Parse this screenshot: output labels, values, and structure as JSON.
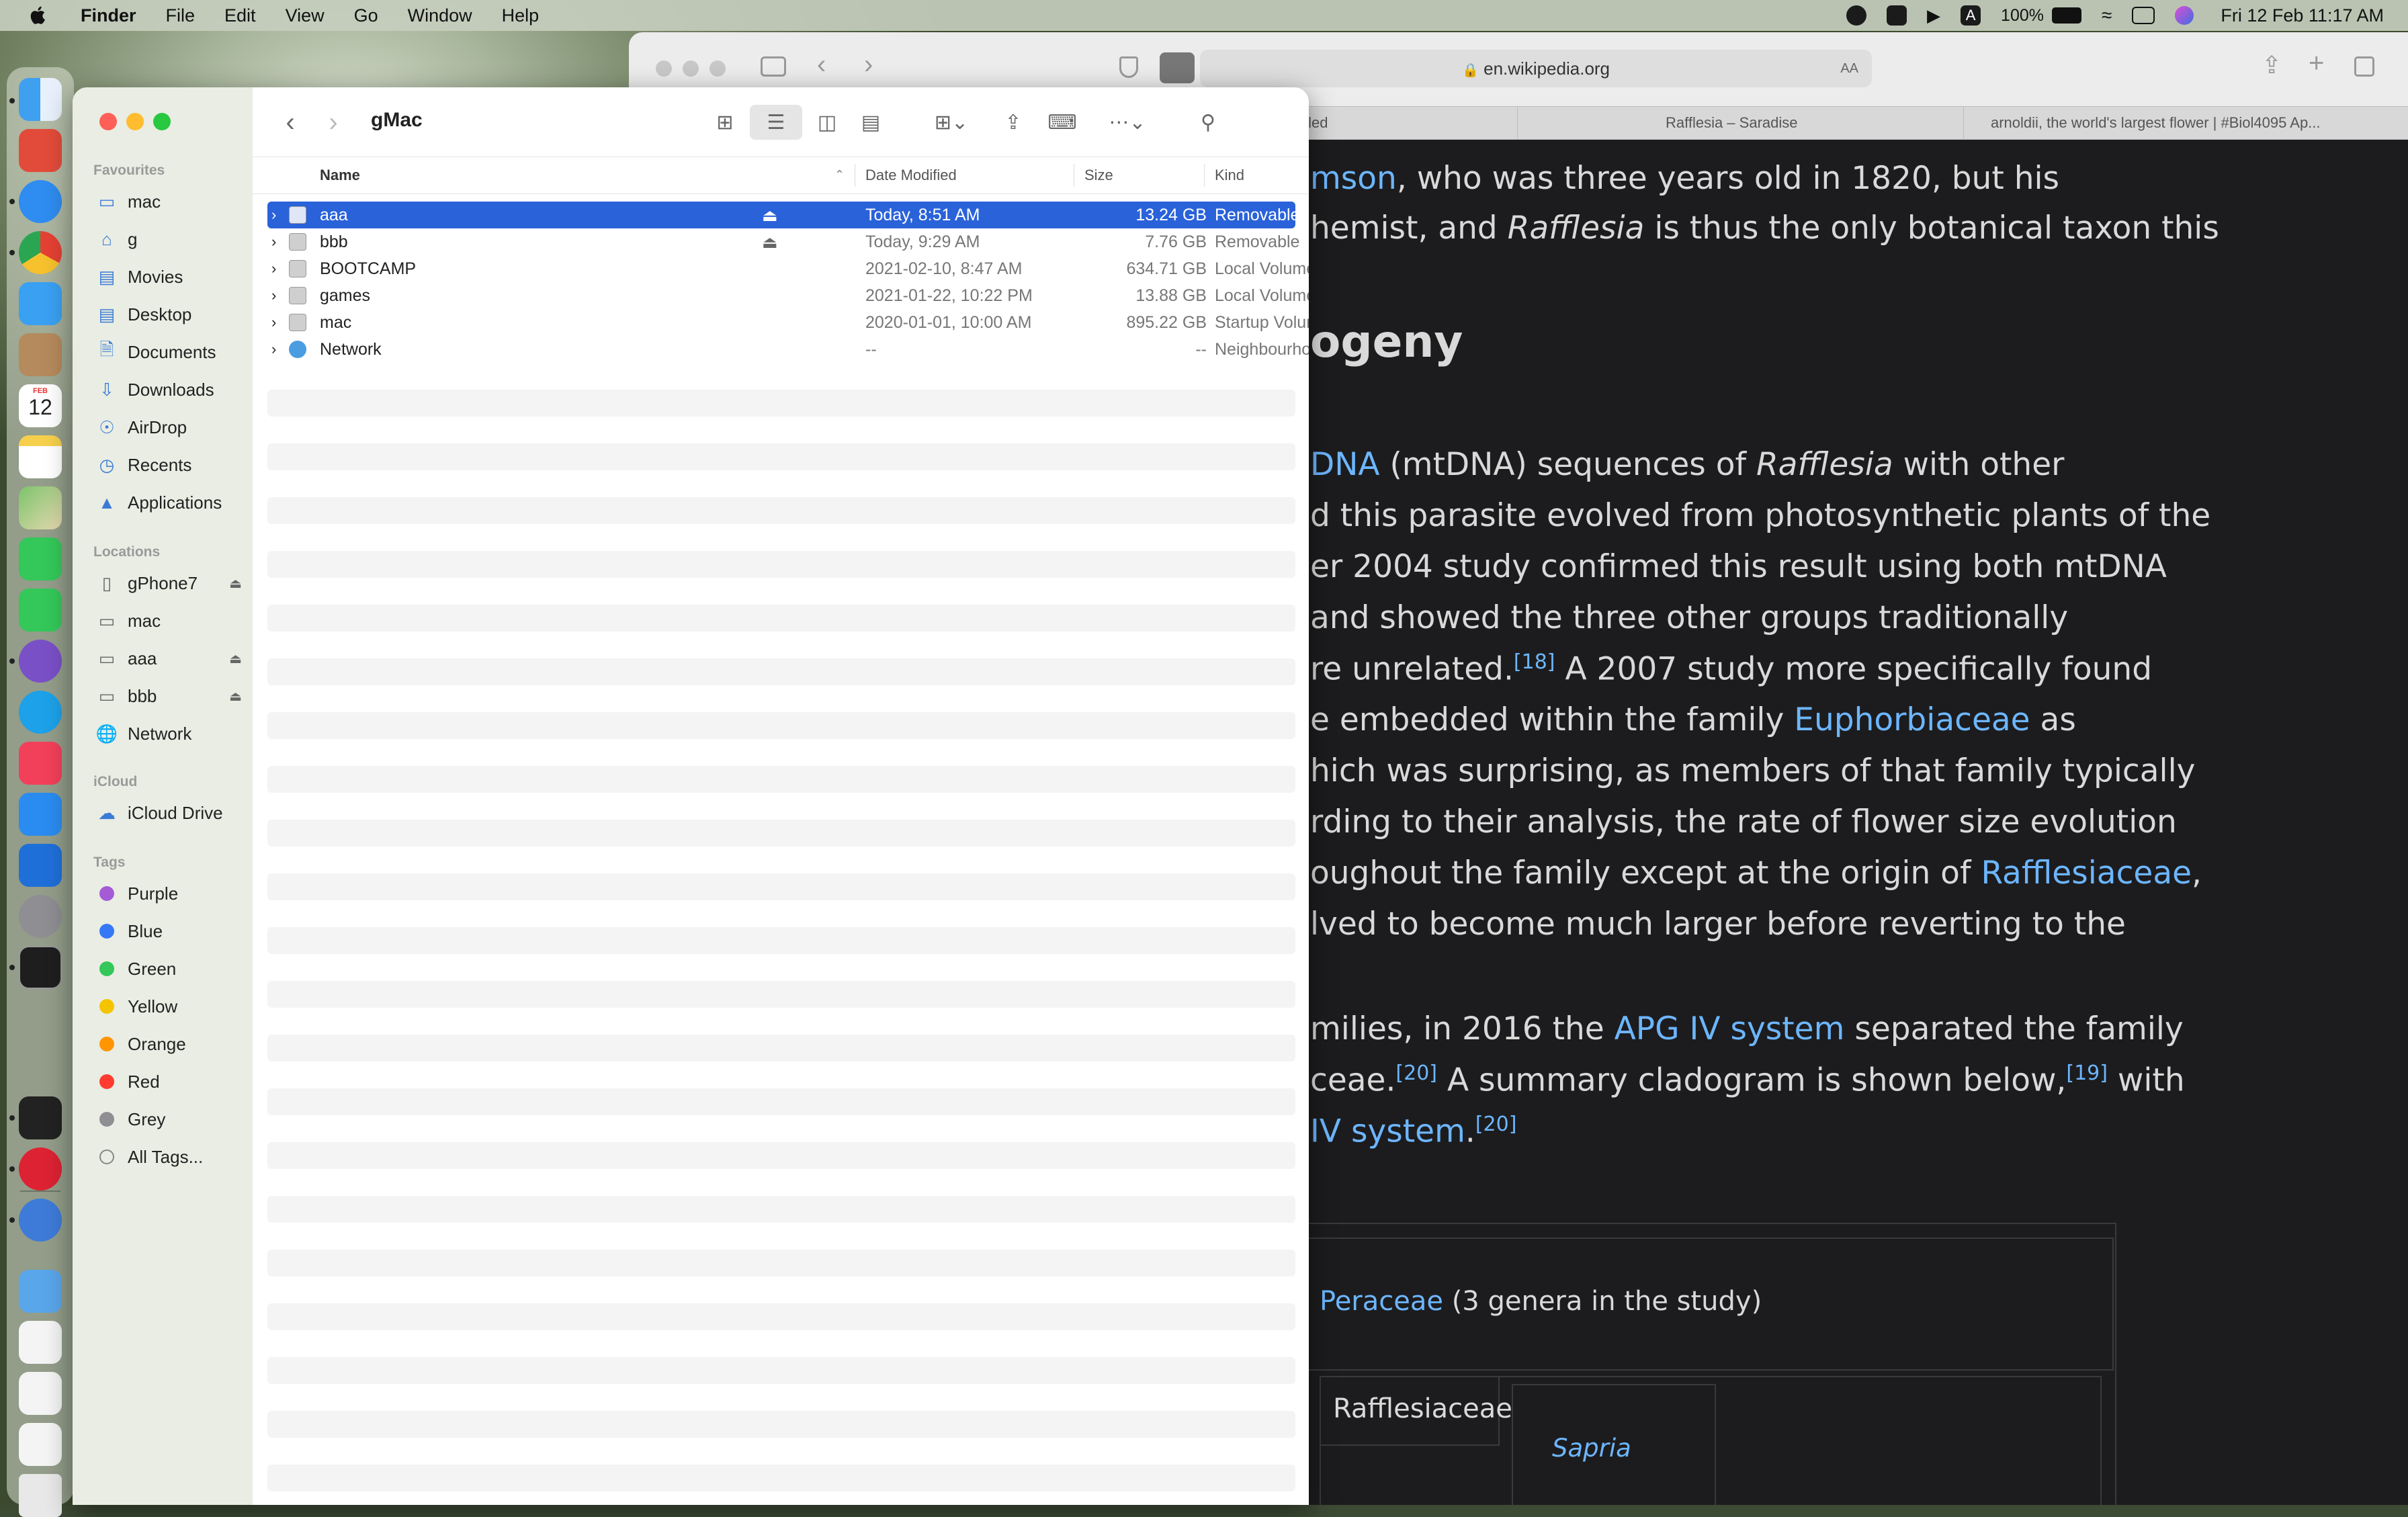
{
  "menubar": {
    "app": "Finder",
    "items": [
      "File",
      "Edit",
      "View",
      "Go",
      "Window",
      "Help"
    ],
    "battery": "100%",
    "datetime": "Fri 12 Feb  11:17 AM"
  },
  "dock": {
    "apps": [
      "finder-icon",
      "launchpad-icon",
      "safari-icon",
      "chrome-icon",
      "mail-icon",
      "contacts-icon",
      "calendar-icon",
      "notes-icon",
      "maps-icon",
      "messages-icon",
      "facetime-icon",
      "viber-icon",
      "skype-icon",
      "music-icon",
      "app-store-icon",
      "xcode-icon",
      "system-preferences-icon",
      "terminal-icon",
      "activity-monitor-icon",
      "disk-utility-icon",
      "qbittorrent-icon",
      "downloads-folder-icon",
      "document-icon",
      "screenshot-icon",
      "document-2-icon",
      "trash-icon"
    ],
    "calendar_day": "12",
    "calendar_month": "FEB"
  },
  "safari": {
    "address": "en.wikipedia.org",
    "reader_label": "AA",
    "tabs": [
      "tled",
      "Rafflesia – Saradise",
      "arnoldii, the world's largest flower | #Biol4095 Ap..."
    ],
    "article": {
      "l1a": "mson",
      "l1b": ", who was three years old in 1820, but his",
      "l2a": "hemist, and ",
      "l2b": "Rafflesia",
      "l2c": " is thus the only botanical taxon this",
      "heading": "ogeny",
      "l3a": "DNA",
      "l3b": " (mtDNA) sequences of ",
      "l3c": "Rafflesia",
      "l3d": " with other",
      "l4": "d this parasite evolved from photosynthetic plants of the",
      "l5": "er 2004 study confirmed this result using both mtDNA",
      "l6": " and showed the three other groups traditionally",
      "l7a": "re unrelated.",
      "l7b": "[18]",
      "l7c": " A 2007 study more specifically found",
      "l8a": "e embedded within the family ",
      "l8b": "Euphorbiaceae",
      "l8c": " as",
      "l9": "hich was surprising, as members of that family typically",
      "l10": "rding to their analysis, the rate of flower size evolution",
      "l11a": "oughout the family except at the origin of ",
      "l11b": "Rafflesiaceae",
      "l11c": ",",
      "l12": "lved to become much larger before reverting to the",
      "l13a": "milies, in 2016 the ",
      "l13b": "APG IV system",
      "l13c": " separated the family",
      "l14a": "ceae.",
      "l14b": "[20]",
      "l14c": " A summary cladogram is shown below,",
      "l14d": "[19]",
      "l14e": " with",
      "l15a": " IV system",
      "l15b": ".",
      "l15c": "[20]",
      "clad1a": "Peraceae",
      "clad1b": " (3 genera in the study)",
      "clad2": "Rafflesiaceae",
      "clad3": "Sapria"
    }
  },
  "finder": {
    "title": "gMac",
    "sidebar": {
      "favourites_header": "Favourites",
      "favourites": [
        {
          "label": "mac",
          "icon": "drive-icon"
        },
        {
          "label": "g",
          "icon": "home-icon"
        },
        {
          "label": "Movies",
          "icon": "folder-icon"
        },
        {
          "label": "Desktop",
          "icon": "folder-icon"
        },
        {
          "label": "Documents",
          "icon": "document-icon"
        },
        {
          "label": "Downloads",
          "icon": "download-icon"
        },
        {
          "label": "AirDrop",
          "icon": "airdrop-icon"
        },
        {
          "label": "Recents",
          "icon": "clock-icon"
        },
        {
          "label": "Applications",
          "icon": "applications-icon"
        }
      ],
      "locations_header": "Locations",
      "locations": [
        {
          "label": "gPhone7",
          "icon": "phone-icon",
          "eject": true
        },
        {
          "label": "mac",
          "icon": "drive-icon",
          "eject": false
        },
        {
          "label": "aaa",
          "icon": "drive-icon",
          "eject": true
        },
        {
          "label": "bbb",
          "icon": "drive-icon",
          "eject": true
        },
        {
          "label": "Network",
          "icon": "globe-icon",
          "eject": false
        }
      ],
      "icloud_header": "iCloud",
      "icloud": [
        {
          "label": "iCloud Drive",
          "icon": "cloud-icon"
        }
      ],
      "tags_header": "Tags",
      "tags": [
        {
          "label": "Purple",
          "color": "#a55bd6"
        },
        {
          "label": "Blue",
          "color": "#3478f6"
        },
        {
          "label": "Green",
          "color": "#34c759"
        },
        {
          "label": "Yellow",
          "color": "#f5c400"
        },
        {
          "label": "Orange",
          "color": "#ff9500"
        },
        {
          "label": "Red",
          "color": "#ff3b30"
        },
        {
          "label": "Grey",
          "color": "#8e8e93"
        },
        {
          "label": "All Tags...",
          "color": ""
        }
      ]
    },
    "columns": {
      "name": "Name",
      "date": "Date Modified",
      "size": "Size",
      "kind": "Kind"
    },
    "rows": [
      {
        "name": "aaa",
        "date": "Today, 8:51 AM",
        "size": "13.24 GB",
        "kind": "Removable",
        "selected": true,
        "eject": true
      },
      {
        "name": "bbb",
        "date": "Today, 9:29 AM",
        "size": "7.76 GB",
        "kind": "Removable",
        "selected": false,
        "eject": true
      },
      {
        "name": "BOOTCAMP",
        "date": "2021-02-10, 8:47 AM",
        "size": "634.71 GB",
        "kind": "Local Volume",
        "selected": false,
        "eject": false
      },
      {
        "name": "games",
        "date": "2021-01-22, 10:22 PM",
        "size": "13.88 GB",
        "kind": "Local Volume",
        "selected": false,
        "eject": false
      },
      {
        "name": "mac",
        "date": "2020-01-01, 10:00 AM",
        "size": "895.22 GB",
        "kind": "Startup Volume",
        "selected": false,
        "eject": false
      },
      {
        "name": "Network",
        "date": "--",
        "size": "--",
        "kind": "Neighbourhood",
        "selected": false,
        "eject": false
      }
    ],
    "colors": {
      "selection": "#2a62d9",
      "accent": "#3a7bd5"
    }
  }
}
